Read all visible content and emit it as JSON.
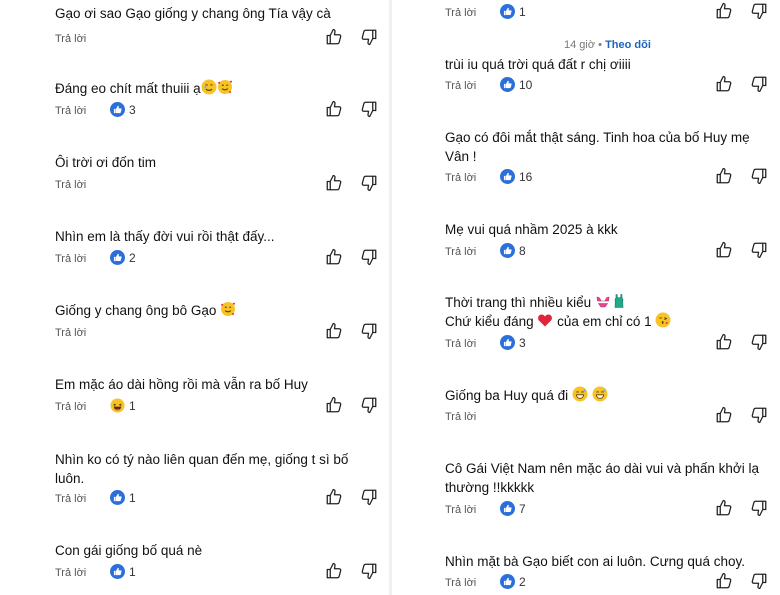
{
  "reply_label": "Trả lời",
  "left_comments": [
    {
      "line1": "Gạo ơi sao Gạo giống y chang ông Tía vậy cà",
      "line2": "",
      "likes": ""
    },
    {
      "line1": "Đáng eo chít mất thuiii ạ",
      "line2": "",
      "likes": "3",
      "emojis": [
        "tearful-smile",
        "smiling-hearts"
      ]
    },
    {
      "line1": "Ôi trời ơi đốn tim",
      "line2": "",
      "likes": ""
    },
    {
      "line1": "Nhìn em là thấy đời vui rồi thật đấy...",
      "line2": "",
      "likes": "2"
    },
    {
      "line1": "Giống y chang ông bô Gạo",
      "line2": "",
      "likes": "",
      "emojis": [
        "smiling-hearts"
      ]
    },
    {
      "line1": "Em mặc áo dài hồng rồi mà vẫn ra bố Huy",
      "line2": "",
      "likes": "1",
      "like_icon": "laugh-emoji"
    },
    {
      "line1": "Nhìn ko có tý nào liên quan đến mẹ, giống t sì bố",
      "line2": "luôn.",
      "likes": "1"
    },
    {
      "line1": "Con gái giống bố quá nè",
      "line2": "",
      "likes": "1"
    }
  ],
  "right_header": {
    "time": "14 giờ",
    "separator": "•",
    "follow": "Theo dõi"
  },
  "right_top_likes": "1",
  "right_comments": [
    {
      "line1": "trùi iu quá trời quá đất r chị ơiiii",
      "line2": "",
      "likes": "10"
    },
    {
      "line1": "Gạo có đôi mắt thật sáng. Tinh hoa của bố Huy mẹ",
      "line2": "Vân !",
      "likes": "16"
    },
    {
      "line1": "Mẹ vui quá nhầm 2025 à kkk",
      "line2": "",
      "likes": "8"
    },
    {
      "line1": "Thời trang thì nhiều kiểu",
      "line2a": "Chứ kiểu đáng",
      "line2b": "của em chỉ có 1",
      "likes": "3",
      "emojis": [
        "bikini",
        "swimsuit",
        "red-heart",
        "kiss-face"
      ]
    },
    {
      "line1": "Giống ba Huy quá đi",
      "line2": "",
      "likes": "",
      "emojis": [
        "grin-sweat",
        "grin-sweat"
      ]
    },
    {
      "line1": "Cô Gái Việt Nam nên mặc áo dài vui và phấn khởi lạ",
      "line2": "thường !!kkkkk",
      "likes": "7"
    },
    {
      "line1": "Nhìn mặt bà Gạo biết con ai luôn. Cưng quá choy.",
      "line2": "",
      "likes": "2"
    }
  ],
  "colors": {
    "like_blue": "#2a6fdb",
    "follow_blue": "#1b63c4",
    "text": "#111111",
    "meta": "#555555"
  }
}
